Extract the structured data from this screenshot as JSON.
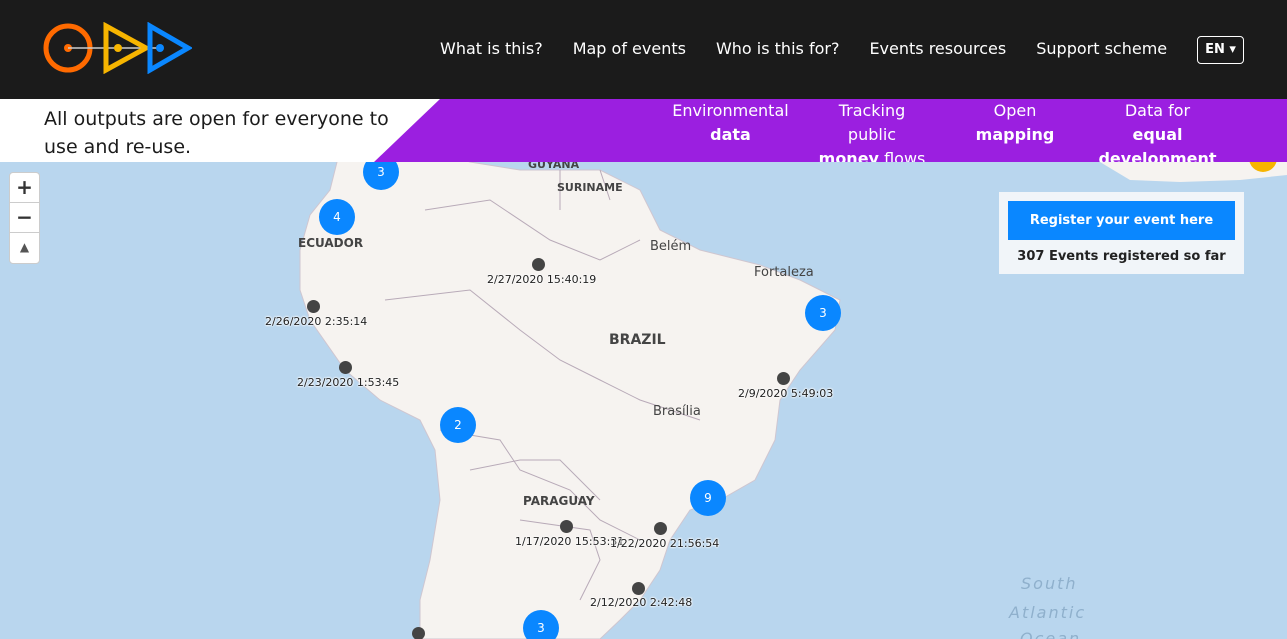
{
  "nav": {
    "items": [
      "What is this?",
      "Map of events",
      "Who is this for?",
      "Events resources",
      "Support scheme"
    ],
    "language": "EN ▾"
  },
  "banner": {
    "text": "All outputs are open for everyone to use and re-use.",
    "pillars": [
      {
        "line1": "Environmental",
        "line2": "data",
        "line3": ""
      },
      {
        "line1": "Tracking",
        "line2": "public",
        "line3": "money flows"
      },
      {
        "line1": "Open",
        "line2": "mapping",
        "line3": ""
      },
      {
        "line1": "Data for",
        "line2": "equal",
        "line3": "development"
      }
    ]
  },
  "register": {
    "button": "Register your event here",
    "count": "307 Events registered so far"
  },
  "zoom": {
    "in": "+",
    "out": "−",
    "compass": "▲"
  },
  "map": {
    "clusters": [
      "3",
      "4",
      "3",
      "2",
      "9",
      "3"
    ],
    "events": [
      "2/27/2020 15:40:19",
      "2/26/2020 2:35:14",
      "2/23/2020 1:53:45",
      "2/9/2020 5:49:03",
      "1/17/2020 15:53:31",
      "1/22/2020 21:56:54",
      "2/12/2020 2:42:48"
    ],
    "countries": [
      "GUYANA",
      "SURINAME",
      "ECUADOR",
      "BRAZIL",
      "PARAGUAY"
    ],
    "cities": [
      "Belém",
      "Fortaleza",
      "Brasília"
    ],
    "ocean": [
      "South",
      "Atlantic",
      "Ocean"
    ]
  },
  "colors": {
    "header": "#1b1b1b",
    "banner": "#9b1fe0",
    "accent": "#0a87ff",
    "ocean": "#b9d6ee",
    "land": "#f6f3f0"
  }
}
